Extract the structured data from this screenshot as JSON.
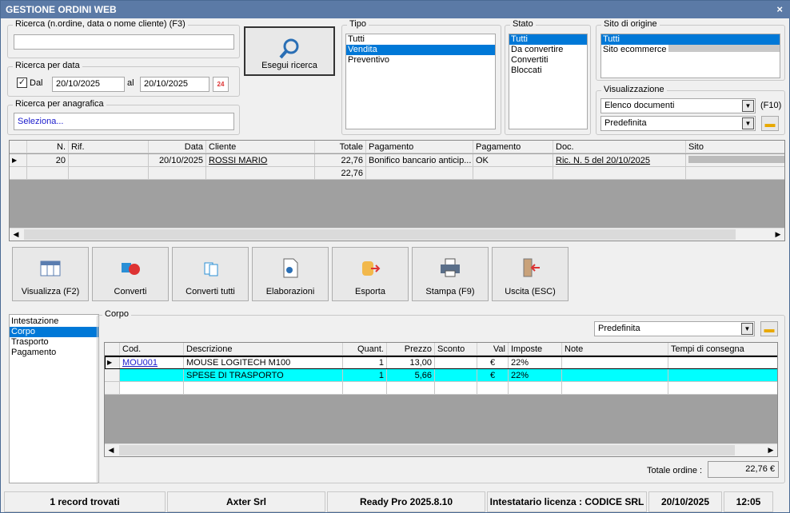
{
  "window": {
    "title": "GESTIONE ORDINI WEB",
    "close": "×"
  },
  "search": {
    "label": "Ricerca (n.ordine, data o nome cliente) (F3)",
    "value": ""
  },
  "date_search": {
    "label": "Ricerca per data",
    "checkbox_label": "Dal",
    "checked": true,
    "from": "20/10/2025",
    "to_label": "al",
    "to": "20/10/2025",
    "calendar_day": "24"
  },
  "registry_search": {
    "label": "Ricerca per anagrafica",
    "value": "Seleziona..."
  },
  "run_search": {
    "label": "Esegui ricerca"
  },
  "tipo": {
    "label": "Tipo",
    "items": [
      "Tutti",
      "Vendita",
      "Preventivo"
    ],
    "selected": "Vendita"
  },
  "stato": {
    "label": "Stato",
    "items": [
      "Tutti",
      "Da convertire",
      "Convertiti",
      "Bloccati"
    ],
    "selected": "Tutti"
  },
  "sito": {
    "label": "Sito di origine",
    "items": [
      "Tutti",
      "Sito ecommerce"
    ],
    "selected": "Tutti"
  },
  "visualizzazione": {
    "label": "Visualizzazione",
    "mode": "Elenco documenti",
    "shortcut": "(F10)",
    "layout": "Predefinita"
  },
  "orders": {
    "columns": [
      "N.",
      "Rif.",
      "Data",
      "Cliente",
      "Totale",
      "Pagamento",
      "Pagamento",
      "Doc.",
      "Sito"
    ],
    "rows": [
      {
        "n": "20",
        "rif": "",
        "data": "20/10/2025",
        "cliente": "ROSSI MARIO",
        "totale": "22,76",
        "pagamento": "Bonifico bancario anticip...",
        "stato_pagamento": "OK",
        "doc": "Ric. N. 5 del 20/10/2025",
        "sito": ""
      }
    ],
    "total": "22,76"
  },
  "toolbar": [
    "Visualizza (F2)",
    "Converti",
    "Converti tutti",
    "Elaborazioni",
    "Esporta",
    "Stampa (F9)",
    "Uscita (ESC)"
  ],
  "sections": {
    "items": [
      "Intestazione",
      "Corpo",
      "Trasporto",
      "Pagamento"
    ],
    "selected": "Corpo"
  },
  "corpo": {
    "label": "Corpo",
    "layout": "Predefinita",
    "columns": [
      "Cod.",
      "Descrizione",
      "Quant.",
      "Prezzo",
      "Sconto",
      "Val",
      "Imposte",
      "Note",
      "Tempi di consegna"
    ],
    "rows": [
      {
        "cod": "MOU001",
        "descrizione": "MOUSE LOGITECH M100",
        "quant": "1",
        "prezzo": "13,00",
        "sconto": "",
        "val": "€",
        "imposte": "22%",
        "note": "",
        "tempi": ""
      },
      {
        "cod": "",
        "descrizione": "SPESE DI TRASPORTO",
        "quant": "1",
        "prezzo": "5,66",
        "sconto": "",
        "val": "€",
        "imposte": "22%",
        "note": "",
        "tempi": ""
      }
    ],
    "total_label": "Totale ordine :",
    "total": "22,76 €"
  },
  "statusbar": [
    "1 record trovati",
    "Axter Srl",
    "Ready Pro 2025.8.10",
    "Intestatario licenza : CODICE SRL",
    "20/10/2025",
    "12:05"
  ]
}
